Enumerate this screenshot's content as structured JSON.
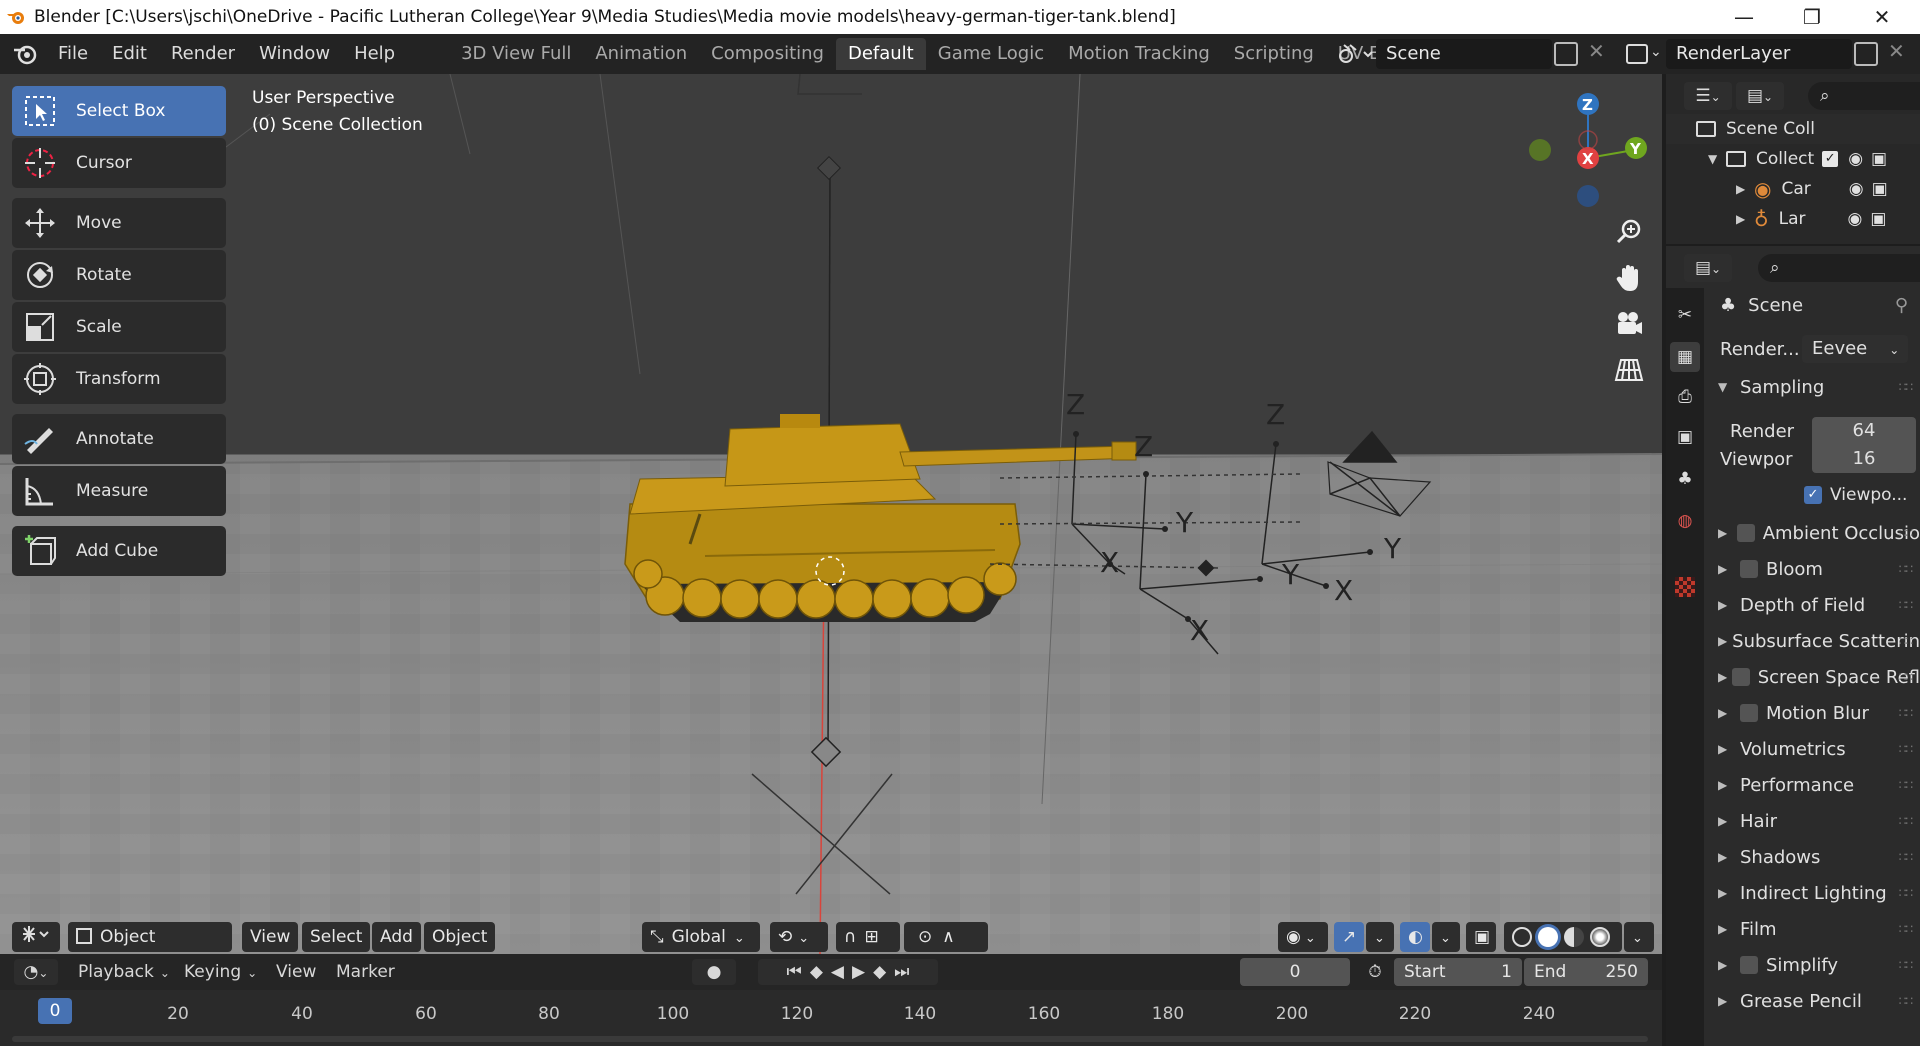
{
  "window": {
    "title": "Blender [C:\\Users\\jschi\\OneDrive - Pacific Lutheran College\\Year 9\\Media Studies\\Media movie models\\heavy-german-tiger-tank.blend]",
    "minimize": "—",
    "restore": "❐",
    "close": "✕"
  },
  "menu": [
    "File",
    "Edit",
    "Render",
    "Window",
    "Help"
  ],
  "workspaces": [
    {
      "label": "3D View Full",
      "active": false
    },
    {
      "label": "Animation",
      "active": false
    },
    {
      "label": "Compositing",
      "active": false
    },
    {
      "label": "Default",
      "active": true
    },
    {
      "label": "Game Logic",
      "active": false
    },
    {
      "label": "Motion Tracking",
      "active": false
    },
    {
      "label": "Scripting",
      "active": false
    },
    {
      "label": "UV Editing",
      "active": false
    }
  ],
  "scene_field": "Scene",
  "renderlayer_field": "RenderLayer",
  "viewport": {
    "perspective": "User Perspective",
    "collection": "(0) Scene Collection",
    "axis_labels": [
      "Z",
      "Y",
      "X"
    ]
  },
  "tools": [
    {
      "label": "Select Box",
      "icon": "select-box-icon",
      "active": true
    },
    {
      "label": "Cursor",
      "icon": "cursor-icon",
      "active": false
    },
    {
      "label": "Move",
      "icon": "move-icon",
      "active": false
    },
    {
      "label": "Rotate",
      "icon": "rotate-icon",
      "active": false
    },
    {
      "label": "Scale",
      "icon": "scale-icon",
      "active": false
    },
    {
      "label": "Transform",
      "icon": "transform-icon",
      "active": false
    },
    {
      "label": "Annotate",
      "icon": "annotate-icon",
      "active": false
    },
    {
      "label": "Measure",
      "icon": "measure-icon",
      "active": false
    },
    {
      "label": "Add Cube",
      "icon": "add-cube-icon",
      "active": false
    }
  ],
  "viewport_header": {
    "mode": "Object Mode",
    "view": "View",
    "select": "Select",
    "add": "Add",
    "object": "Object",
    "transform_orientation": "Global"
  },
  "timeline": {
    "playback": "Playback",
    "keying": "Keying",
    "view": "View",
    "marker": "Marker",
    "current_frame": "0",
    "start_label": "Start",
    "start_value": "1",
    "end_label": "End",
    "end_value": "250",
    "ruler": [
      "0",
      "20",
      "40",
      "60",
      "80",
      "100",
      "120",
      "140",
      "160",
      "180",
      "200",
      "220",
      "240"
    ],
    "playhead": "0"
  },
  "outliner": {
    "root": "Scene Coll",
    "collection": "Collect",
    "items": [
      "Car",
      "Lar"
    ]
  },
  "properties": {
    "context": "Scene",
    "render_engine_label": "Render...",
    "render_engine_value": "Eevee",
    "sampling": "Sampling",
    "render_label": "Render",
    "render_value": "64",
    "viewport_label": "Viewpor",
    "viewport_value": "16",
    "viewport_denoise": "Viewpo...",
    "sections": [
      {
        "label": "Ambient Occlusio",
        "checkbox": true
      },
      {
        "label": "Bloom",
        "checkbox": true
      },
      {
        "label": "Depth of Field",
        "checkbox": false
      },
      {
        "label": "Subsurface Scatterin",
        "checkbox": false
      },
      {
        "label": "Screen Space Refl",
        "checkbox": true
      },
      {
        "label": "Motion Blur",
        "checkbox": true
      },
      {
        "label": "Volumetrics",
        "checkbox": false
      },
      {
        "label": "Performance",
        "checkbox": false
      },
      {
        "label": "Hair",
        "checkbox": false
      },
      {
        "label": "Shadows",
        "checkbox": false
      },
      {
        "label": "Indirect Lighting",
        "checkbox": false
      },
      {
        "label": "Film",
        "checkbox": false
      },
      {
        "label": "Simplify",
        "checkbox": true
      },
      {
        "label": "Grease Pencil",
        "checkbox": false
      }
    ]
  }
}
